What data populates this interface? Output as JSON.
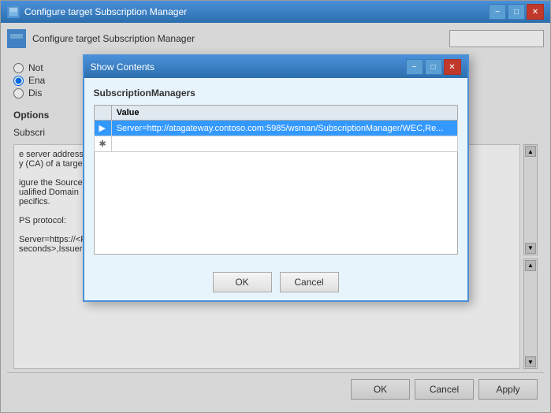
{
  "window": {
    "title": "Configure target Subscription Manager",
    "title_bar_controls": {
      "minimize": "−",
      "maximize": "□",
      "close": "✕"
    }
  },
  "main": {
    "header_title": "Configure target Subscription Manager",
    "search_placeholder": "",
    "radio_options": [
      {
        "id": "not",
        "label": "Not",
        "checked": false
      },
      {
        "id": "ena",
        "label": "Ena",
        "checked": true
      },
      {
        "id": "dis",
        "label": "Dis",
        "checked": false
      }
    ],
    "options_label": "Options",
    "subscr_label": "Subscri",
    "description_text": "e server address,\ny (CA) of a target\n\nigure the Source\nualified Domain\npecifics.\n\nPS protocol:\n\nServer=https://<FQDN of the collector>:5986/wsman/SubscriptionManager/WEC,Refresh=<Refresh interval in seconds>,IssuerCA=<Thumb print of the client authentication certificate>. When using the HTTP protocol, use",
    "bottom_buttons": {
      "ok": "OK",
      "cancel": "Cancel",
      "apply": "Apply"
    }
  },
  "modal": {
    "title": "Show Contents",
    "controls": {
      "minimize": "−",
      "maximize": "□",
      "close": "✕"
    },
    "section_title": "SubscriptionManagers",
    "table": {
      "column_header": "Value",
      "rows": [
        {
          "selected": true,
          "arrow": "▶",
          "value": "Server=http://atagateway.contoso.com:5985/wsman/SubscriptionManager/WEC,Re..."
        },
        {
          "selected": false,
          "arrow": "✱",
          "value": ""
        }
      ]
    },
    "footer_buttons": {
      "ok": "OK",
      "cancel": "Cancel"
    }
  }
}
